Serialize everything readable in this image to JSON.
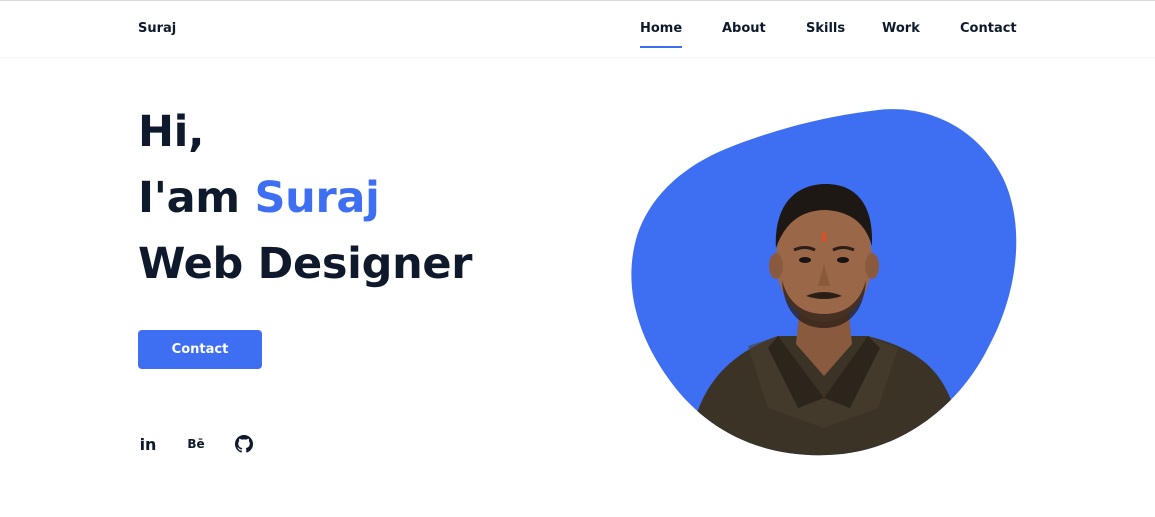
{
  "brand": {
    "logo_text": "Suraj",
    "accent_color": "#3e6ff2",
    "text_color": "#0e1a2b"
  },
  "nav": {
    "items": [
      {
        "label": "Home",
        "active": true
      },
      {
        "label": "About",
        "active": false
      },
      {
        "label": "Skills",
        "active": false
      },
      {
        "label": "Work",
        "active": false
      },
      {
        "label": "Contact",
        "active": false
      }
    ]
  },
  "hero": {
    "greeting": "Hi,",
    "intro": "I'am ",
    "name": "Suraj",
    "role": "Web Designer",
    "cta_label": "Contact"
  },
  "social": [
    {
      "icon": "linkedin-icon",
      "label": "in"
    },
    {
      "icon": "behance-icon",
      "label": "Bē"
    },
    {
      "icon": "github-icon",
      "label": ""
    }
  ],
  "profile": {
    "image": "profile-photo",
    "blob_color": "#3e6ff2"
  }
}
